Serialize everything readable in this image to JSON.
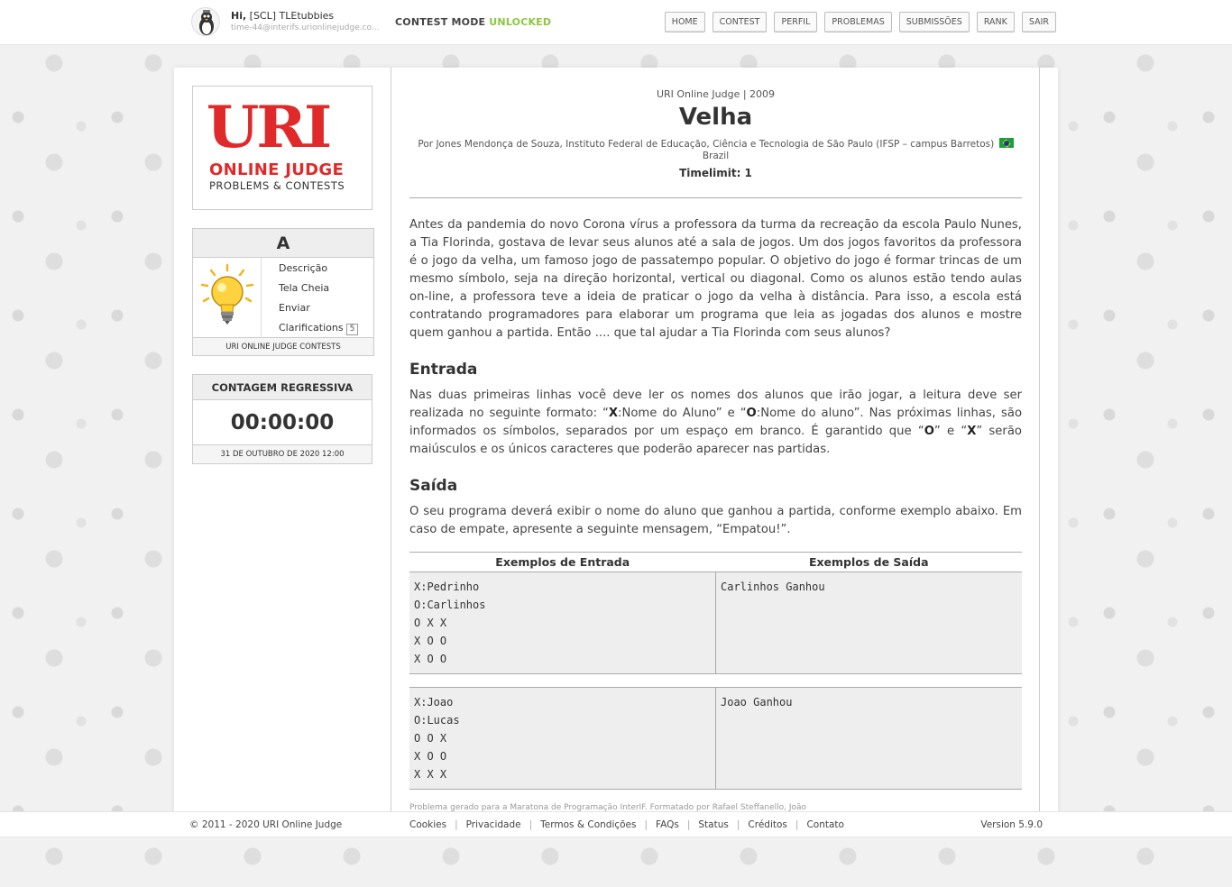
{
  "header": {
    "greeting_prefix": "Hi,",
    "username": "[SCL] TLEtubbies",
    "email": "time-44@interifs.urionlinejudge.co...",
    "contest_mode_label": "CONTEST MODE",
    "contest_mode_status": "UNLOCKED",
    "nav": [
      "HOME",
      "CONTEST",
      "PERFIL",
      "PROBLEMAS",
      "SUBMISSÕES",
      "RANK",
      "SAIR"
    ]
  },
  "logo": {
    "main": "URI",
    "sub": "ONLINE JUDGE",
    "tagline": "PROBLEMS & CONTESTS"
  },
  "problem_box": {
    "letter": "A",
    "links": [
      "Descrição",
      "Tela Cheia",
      "Enviar",
      "Clarifications"
    ],
    "clarifications_count": "5",
    "footer": "URI ONLINE JUDGE CONTESTS"
  },
  "countdown": {
    "title": "CONTAGEM REGRESSIVA",
    "time": "00:00:00",
    "date": "31 DE OUTUBRO DE 2020 12:00"
  },
  "problem": {
    "source": "URI Online Judge | 2009",
    "title": "Velha",
    "author": "Por Jones Mendonça de Souza, Instituto Federal de Educação, Ciência e Tecnologia de São Paulo (IFSP – campus Barretos)",
    "country": "Brazil",
    "timelimit": "Timelimit: 1",
    "description": "Antes da pandemia do novo Corona vírus a professora da turma da recreação da escola Paulo Nunes, a Tia Florinda, gostava de levar seus alunos até a sala de jogos. Um dos jogos favoritos da professora é o jogo da velha, um famoso jogo de passatempo popular. O objetivo do jogo é formar trincas de um mesmo símbolo, seja na direção horizontal, vertical ou diagonal. Como os alunos estão tendo aulas on-line, a professora teve a ideia de praticar o jogo da velha à distância. Para isso, a escola está contratando programadores para elaborar um programa que leia as jogadas dos alunos e mostre quem ganhou a partida. Então .... que tal ajudar a Tia Florinda com seus alunos?",
    "input_title": "Entrada",
    "input_text": {
      "p1": "Nas duas primeiras linhas você deve ler os nomes dos alunos que irão jogar, a leitura deve ser realizada no seguinte formato: “",
      "x1": "X",
      "p2": ":Nome do Aluno” e “",
      "o1": "O",
      "p3": ":Nome do aluno”. Nas próximas linhas, são informados os símbolos, separados por um espaço em branco. É garantido que “",
      "o2": "O",
      "p4": "” e “",
      "x2": "X",
      "p5": "” serão maiúsculos e os únicos caracteres que poderão aparecer nas partidas."
    },
    "output_title": "Saída",
    "output_text": "O seu programa deverá exibir o nome do aluno que ganhou a partida, conforme exemplo abaixo. Em caso de empate, apresente a seguinte mensagem, “Empatou!”.",
    "examples_input_header": "Exemplos de Entrada",
    "examples_output_header": "Exemplos de Saída",
    "examples": [
      {
        "input": [
          "X:Pedrinho",
          "O:Carlinhos",
          "O X X",
          "X O O",
          "X O O"
        ],
        "output": [
          "Carlinhos Ganhou"
        ]
      },
      {
        "input": [
          "X:Joao",
          "O:Lucas",
          "O O X",
          "X O O",
          "X X X"
        ],
        "output": [
          "Joao Ganhou"
        ]
      }
    ],
    "credit": "Problema gerado para a Maratona de Programação InterIF. Formatado por Rafael Steffanello, João"
  },
  "footer": {
    "copyright": "© 2011 - 2020 URI Online Judge",
    "links": [
      "Cookies",
      "Privacidade",
      "Termos & Condições",
      "FAQs",
      "Status",
      "Créditos",
      "Contato"
    ],
    "version": "Version 5.9.0"
  },
  "colors": {
    "brand_red": "#e02a2a",
    "unlocked_green": "#8dc63f",
    "example_bg": "#eeeeee"
  }
}
